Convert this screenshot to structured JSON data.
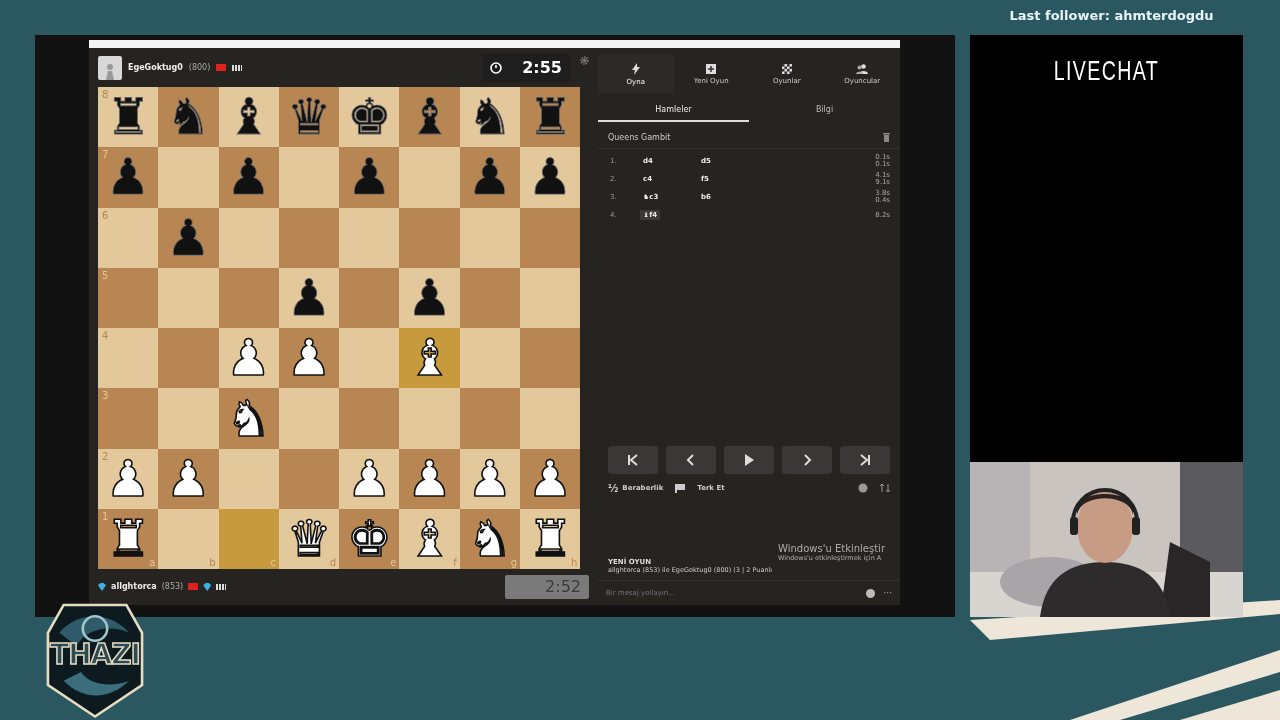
{
  "stream": {
    "last_follower": "Last follower: ahmterdogdu",
    "chat_title": "LIVECHAT",
    "logo_text": "THAZI"
  },
  "top_player": {
    "name": "EgeGoktug0",
    "rating": "(800)",
    "clock": "2:55",
    "running": true
  },
  "bottom_player": {
    "name": "allghtorca",
    "rating": "(853)",
    "clock": "2:52",
    "running": false
  },
  "board": {
    "files": [
      "a",
      "b",
      "c",
      "d",
      "e",
      "f",
      "g",
      "h"
    ],
    "ranks": [
      {
        "label": "8",
        "squares": [
          {
            "piece": "♜",
            "white": false,
            "highlighted": false
          },
          {
            "piece": "♞",
            "white": false,
            "highlighted": false
          },
          {
            "piece": "♝",
            "white": false,
            "highlighted": false
          },
          {
            "piece": "♛",
            "white": false,
            "highlighted": false
          },
          {
            "piece": "♚",
            "white": false,
            "highlighted": false
          },
          {
            "piece": "♝",
            "white": false,
            "highlighted": false
          },
          {
            "piece": "♞",
            "white": false,
            "highlighted": false
          },
          {
            "piece": "♜",
            "white": false,
            "highlighted": false
          }
        ]
      },
      {
        "label": "7",
        "squares": [
          {
            "piece": "♟",
            "white": false,
            "highlighted": false
          },
          {
            "highlighted": false
          },
          {
            "piece": "♟",
            "white": false,
            "highlighted": false
          },
          {
            "highlighted": false
          },
          {
            "piece": "♟",
            "white": false,
            "highlighted": false
          },
          {
            "highlighted": false
          },
          {
            "piece": "♟",
            "white": false,
            "highlighted": false
          },
          {
            "piece": "♟",
            "white": false,
            "highlighted": false
          }
        ]
      },
      {
        "label": "6",
        "squares": [
          {
            "highlighted": false
          },
          {
            "piece": "♟",
            "white": false,
            "highlighted": false
          },
          {
            "highlighted": false
          },
          {
            "highlighted": false
          },
          {
            "highlighted": false
          },
          {
            "highlighted": false
          },
          {
            "highlighted": false
          },
          {
            "highlighted": false
          }
        ]
      },
      {
        "label": "5",
        "squares": [
          {
            "highlighted": false
          },
          {
            "highlighted": false
          },
          {
            "highlighted": false
          },
          {
            "piece": "♟",
            "white": false,
            "highlighted": false
          },
          {
            "highlighted": false
          },
          {
            "piece": "♟",
            "white": false,
            "highlighted": false
          },
          {
            "highlighted": false
          },
          {
            "highlighted": false
          }
        ]
      },
      {
        "label": "4",
        "squares": [
          {
            "highlighted": false
          },
          {
            "highlighted": false
          },
          {
            "piece": "♟",
            "white": true,
            "highlighted": false
          },
          {
            "piece": "♟",
            "white": true,
            "highlighted": false
          },
          {
            "highlighted": false
          },
          {
            "piece": "♝",
            "white": true,
            "highlighted": true
          },
          {
            "highlighted": false
          },
          {
            "highlighted": false
          }
        ]
      },
      {
        "label": "3",
        "squares": [
          {
            "highlighted": false
          },
          {
            "highlighted": false
          },
          {
            "piece": "♞",
            "white": true,
            "highlighted": false
          },
          {
            "highlighted": false
          },
          {
            "highlighted": false
          },
          {
            "highlighted": false
          },
          {
            "highlighted": false
          },
          {
            "highlighted": false
          }
        ]
      },
      {
        "label": "2",
        "squares": [
          {
            "piece": "♟",
            "white": true,
            "highlighted": false
          },
          {
            "piece": "♟",
            "white": true,
            "highlighted": false
          },
          {
            "highlighted": false
          },
          {
            "highlighted": false
          },
          {
            "piece": "♟",
            "white": true,
            "highlighted": false
          },
          {
            "piece": "♟",
            "white": true,
            "highlighted": false
          },
          {
            "piece": "♟",
            "white": true,
            "highlighted": false
          },
          {
            "piece": "♟",
            "white": true,
            "highlighted": false
          }
        ]
      },
      {
        "label": "1",
        "squares": [
          {
            "piece": "♜",
            "white": true,
            "highlighted": false
          },
          {
            "highlighted": false
          },
          {
            "highlighted": true
          },
          {
            "piece": "♛",
            "white": true,
            "highlighted": false
          },
          {
            "piece": "♚",
            "white": true,
            "highlighted": false
          },
          {
            "piece": "♝",
            "white": true,
            "highlighted": false
          },
          {
            "piece": "♞",
            "white": true,
            "highlighted": false
          },
          {
            "piece": "♜",
            "white": true,
            "highlighted": false
          }
        ]
      }
    ]
  },
  "tabs": [
    {
      "label": "Oyna",
      "selected": true
    },
    {
      "label": "Yeni Oyun",
      "selected": false
    },
    {
      "label": "Oyunlar",
      "selected": false
    },
    {
      "label": "Oyuncular",
      "selected": false
    }
  ],
  "subtabs": [
    {
      "label": "Hamleler",
      "selected": true
    },
    {
      "label": "Bilgi",
      "selected": false
    }
  ],
  "opening": "Queens Gambit",
  "moves": [
    {
      "number": "1.",
      "white": "d4",
      "black": "d5",
      "times": [
        "0.1s",
        "0.1s"
      ],
      "selected": false
    },
    {
      "number": "2.",
      "white": "c4",
      "black": "f5",
      "times": [
        "4.1s",
        "9.1s"
      ],
      "selected": false
    },
    {
      "number": "3.",
      "white": "♞c3",
      "black": "b6",
      "times": [
        "3.8s",
        "0.4s"
      ],
      "selected": false
    },
    {
      "number": "4.",
      "white": "♝f4",
      "times": [
        "8.2s"
      ],
      "selected": true
    }
  ],
  "actions": {
    "draw_symbol": "½",
    "draw": "Beraberlik",
    "resign": "Terk Et"
  },
  "chat": {
    "title": "YENİ OYUN",
    "message": "allghtorca (853) ile EgeGoktug0 (800) (3 | 2 Puanlı",
    "placeholder": "Bir mesaj yollayın...",
    "more": "···"
  },
  "os_notice": {
    "title": "Windows'u Etkinleştir",
    "subtitle": "Windows'u etkinleştirmek için A"
  }
}
